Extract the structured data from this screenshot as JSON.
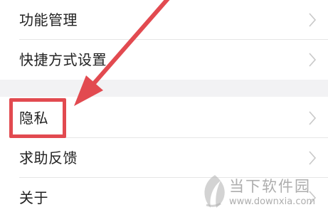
{
  "settings": {
    "items": [
      {
        "label": "功能管理"
      },
      {
        "label": "快捷方式设置"
      },
      {
        "label": "隐私"
      },
      {
        "label": "求助反馈"
      },
      {
        "label": "关于"
      }
    ]
  },
  "annotation": {
    "color": "#e24a50",
    "highlighted_item": "隐私"
  },
  "watermark": {
    "title": "当下软件园",
    "url": "www.downxia.com",
    "logo_icon": "leaf-logo-icon"
  },
  "icons": {
    "chevron": "chevron-right-icon",
    "arrow": "annotation-arrow-icon"
  }
}
